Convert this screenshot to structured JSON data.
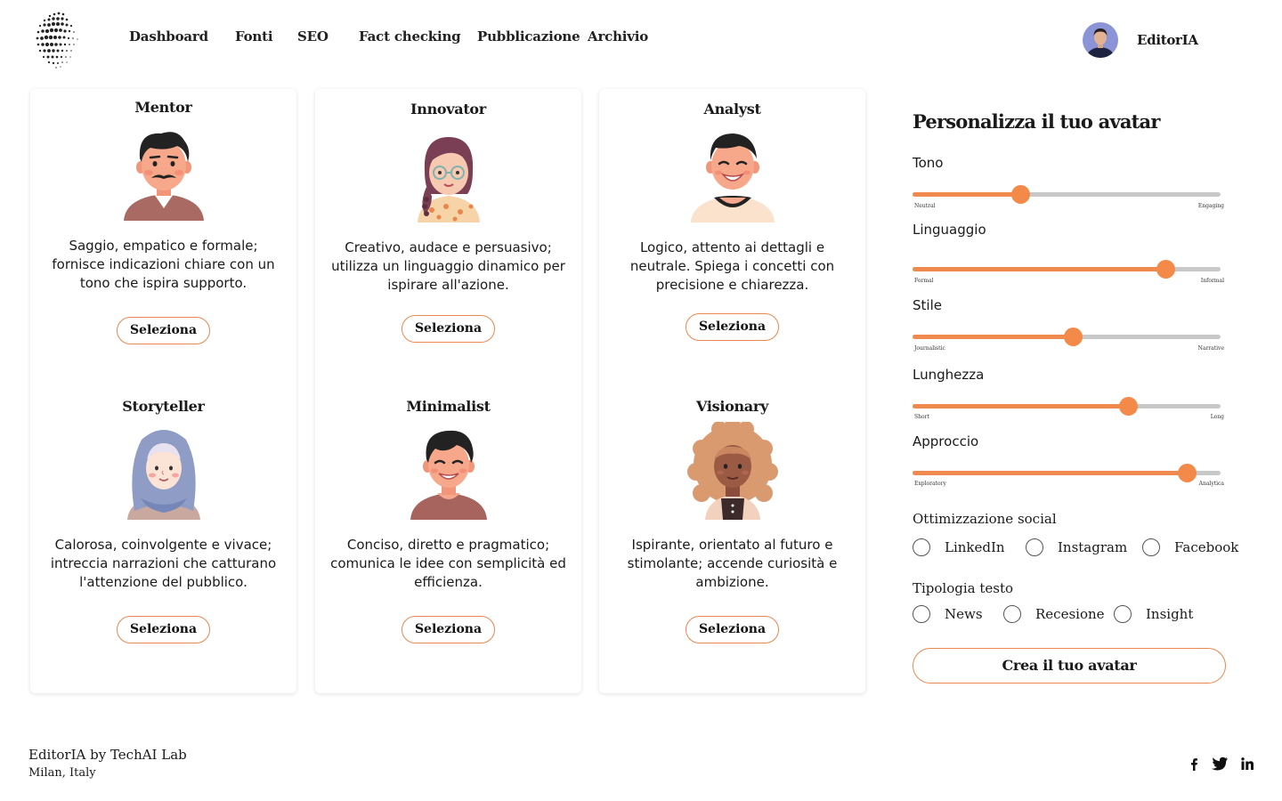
{
  "header": {
    "nav": [
      {
        "label": "Dashboard"
      },
      {
        "label": "Fonti"
      },
      {
        "label": "SEO"
      },
      {
        "label": "Fact checking"
      },
      {
        "label": "Pubblicazione"
      },
      {
        "label": "Archivio"
      }
    ],
    "profile_name": "EditorIA"
  },
  "personas": [
    {
      "name": "Mentor",
      "description": "Saggio, empatico e formale; fornisce indicazioni chiare con un tono che ispira supporto.",
      "button": "Seleziona"
    },
    {
      "name": "Innovator",
      "description": "Creativo, audace e persuasivo; utilizza un linguaggio dinamico per ispirare all'azione.",
      "button": "Seleziona"
    },
    {
      "name": "Analyst",
      "description": "Logico, attento ai dettagli e neutrale. Spiega i concetti con precisione e chiarezza.",
      "button": "Seleziona"
    },
    {
      "name": "Storyteller",
      "description": "Calorosa, coinvolgente e vivace; intreccia narrazioni che catturano l'attenzione del pubblico.",
      "button": "Seleziona"
    },
    {
      "name": "Minimalist",
      "description": "Conciso, diretto e pragmatico; comunica le idee con semplicità ed efficienza.",
      "button": "Seleziona"
    },
    {
      "name": "Visionary",
      "description": "Ispirante, orientato al futuro e stimolante; accende curiosità e ambizione.",
      "button": "Seleziona"
    }
  ],
  "panel": {
    "title": "Personalizza il tuo avatar",
    "sliders": [
      {
        "label": "Tono",
        "min_label": "Neutral",
        "max_label": "Engaging",
        "value": 0.35
      },
      {
        "label": "Linguaggio",
        "min_label": "Formal",
        "max_label": "Informal",
        "value": 0.82
      },
      {
        "label": "Stile",
        "min_label": "Journalistic",
        "max_label": "Narrative",
        "value": 0.52
      },
      {
        "label": "Lunghezza",
        "min_label": "Short",
        "max_label": "Long",
        "value": 0.7
      },
      {
        "label": "Approccio",
        "min_label": "Exploratory",
        "max_label": "Analytica",
        "value": 0.89
      }
    ],
    "social_label": "Ottimizzazione social",
    "social_options": [
      "LinkedIn",
      "Instagram",
      "Facebook"
    ],
    "text_type_label": "Tipologia testo",
    "text_type_options": [
      "News",
      "Recesione",
      "Insight"
    ],
    "create_button": "Crea il tuo avatar"
  },
  "footer": {
    "brand": "EditorIA by TechAI Lab",
    "location": "Milan, Italy",
    "social_icons": [
      "facebook-icon",
      "twitter-icon",
      "linkedin-icon"
    ]
  },
  "colors": {
    "accent": "#f38a4a",
    "track": "#c8c8c8"
  }
}
